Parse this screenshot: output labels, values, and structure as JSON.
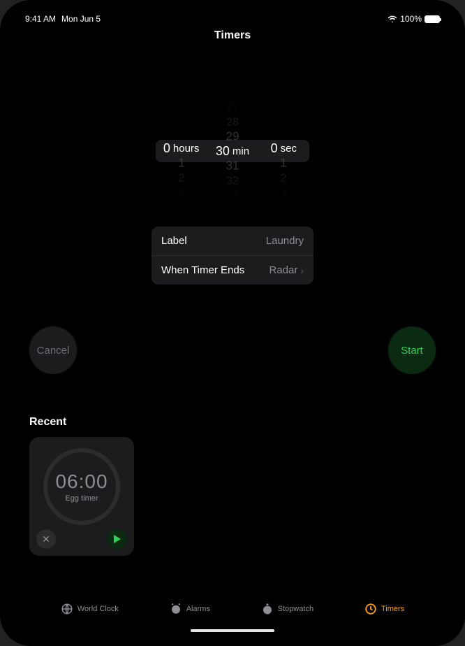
{
  "status": {
    "time": "9:41 AM",
    "date": "Mon Jun 5",
    "battery_pct": "100%"
  },
  "title": "Timers",
  "picker": {
    "hours": {
      "value": "0",
      "unit": "hours",
      "before": [
        "",
        "",
        ""
      ],
      "after": [
        "1",
        "2",
        "3"
      ]
    },
    "minutes": {
      "value": "30",
      "unit": "min",
      "before": [
        "27",
        "28",
        "29"
      ],
      "after": [
        "31",
        "32",
        "33"
      ]
    },
    "seconds": {
      "value": "0",
      "unit": "sec",
      "before": [
        "",
        "",
        ""
      ],
      "after": [
        "1",
        "2",
        "3"
      ]
    }
  },
  "settings": {
    "label_key": "Label",
    "label_value": "Laundry",
    "ends_key": "When Timer Ends",
    "ends_value": "Radar"
  },
  "buttons": {
    "cancel": "Cancel",
    "start": "Start"
  },
  "recent": {
    "header": "Recent",
    "items": [
      {
        "time": "06:00",
        "label": "Egg timer"
      }
    ]
  },
  "tabs": {
    "world": "World Clock",
    "alarms": "Alarms",
    "stopwatch": "Stopwatch",
    "timers": "Timers"
  }
}
